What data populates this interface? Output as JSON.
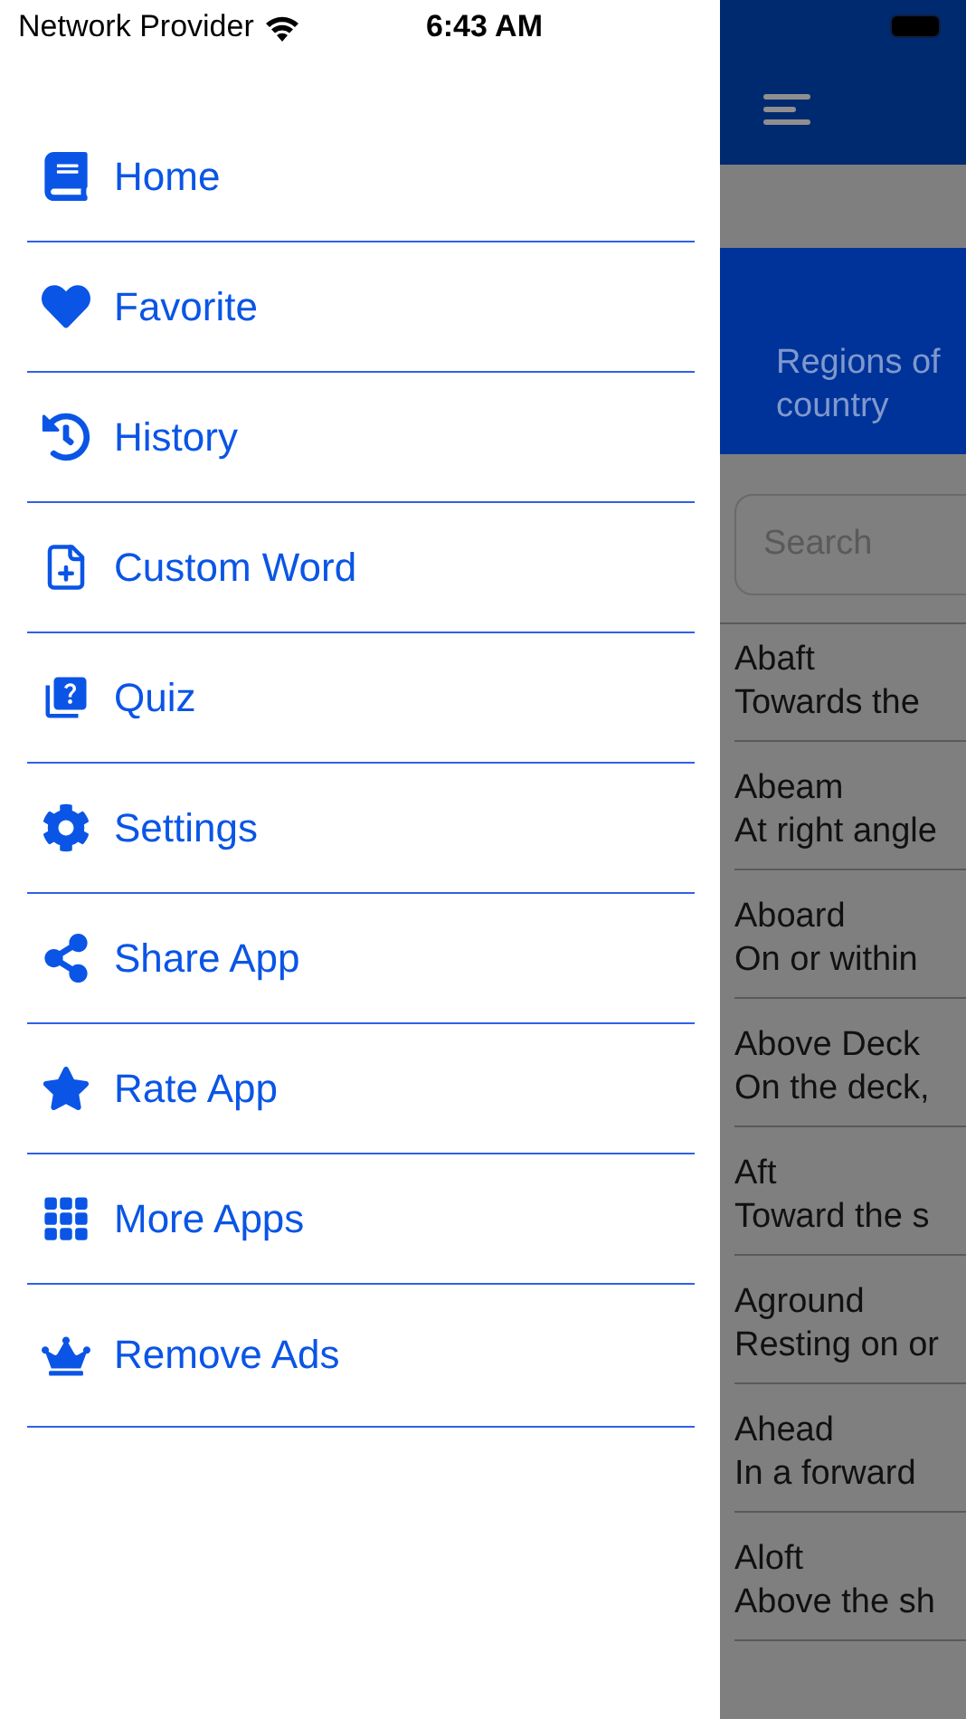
{
  "status_bar": {
    "carrier": "Network Provider",
    "time": "6:43 AM"
  },
  "menu": [
    {
      "label": "Home"
    },
    {
      "label": "Favorite"
    },
    {
      "label": "History"
    },
    {
      "label": "Custom Word"
    },
    {
      "label": "Quiz"
    },
    {
      "label": "Settings"
    },
    {
      "label": "Share App"
    },
    {
      "label": "Rate App"
    },
    {
      "label": "More Apps"
    },
    {
      "label": "Remove Ads"
    }
  ],
  "background": {
    "banner": [
      "Regions of",
      "country"
    ],
    "search": {
      "placeholder": "Search"
    },
    "terms": [
      {
        "term": "Abaft",
        "definition": "Towards the"
      },
      {
        "term": "Abeam",
        "definition": "At right angle"
      },
      {
        "term": "Aboard",
        "definition": "On or within"
      },
      {
        "term": "Above Deck",
        "definition": "On the deck,"
      },
      {
        "term": "Aft",
        "definition": "Toward the s"
      },
      {
        "term": "Aground",
        "definition": "Resting on or"
      },
      {
        "term": "Ahead",
        "definition": "In a forward"
      },
      {
        "term": "Aloft",
        "definition": "Above the sh"
      }
    ]
  }
}
